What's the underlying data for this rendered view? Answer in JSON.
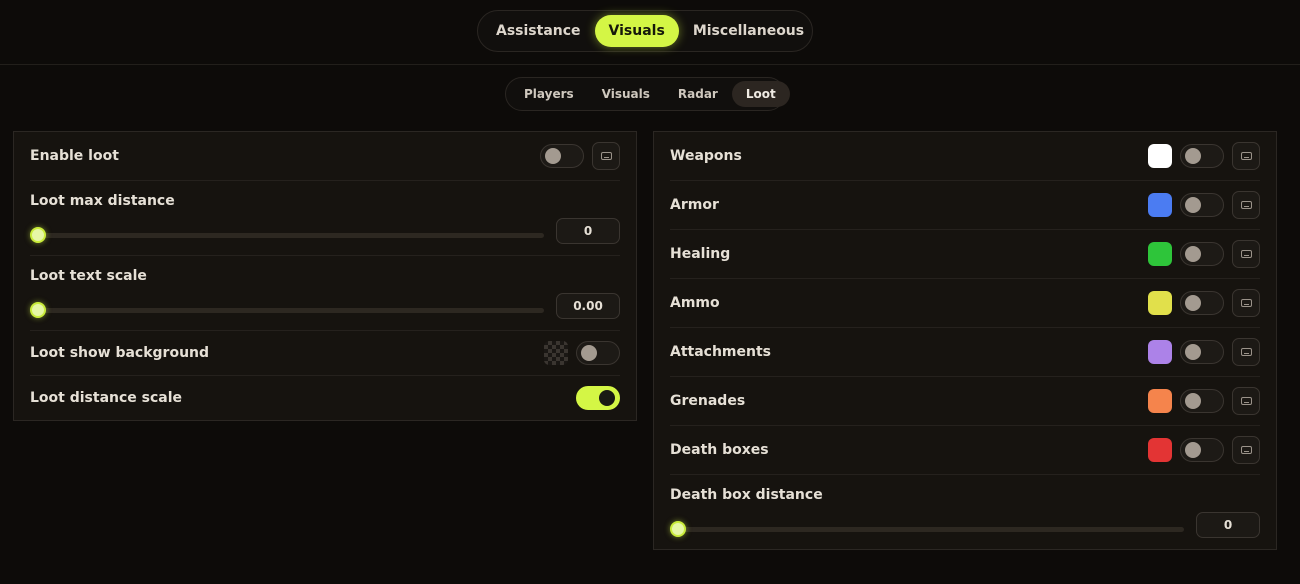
{
  "top_tabs": [
    {
      "label": "Assistance",
      "active": false
    },
    {
      "label": "Visuals",
      "active": true
    },
    {
      "label": "Miscellaneous",
      "active": false
    }
  ],
  "sub_tabs": [
    {
      "label": "Players",
      "active": false
    },
    {
      "label": "Visuals",
      "active": false
    },
    {
      "label": "Radar",
      "active": false
    },
    {
      "label": "Loot",
      "active": true
    }
  ],
  "left_panel": {
    "enable_loot": {
      "label": "Enable loot",
      "on": false
    },
    "loot_max_distance": {
      "label": "Loot max distance",
      "value": "0",
      "fraction": 0
    },
    "loot_text_scale": {
      "label": "Loot text scale",
      "value": "0.00",
      "fraction": 0
    },
    "loot_show_background": {
      "label": "Loot show background",
      "on": false
    },
    "loot_distance_scale": {
      "label": "Loot distance scale",
      "on": true
    }
  },
  "right_panel": {
    "items": [
      {
        "label": "Weapons",
        "color": "#ffffff",
        "on": false
      },
      {
        "label": "Armor",
        "color": "#4b7cf2",
        "on": false
      },
      {
        "label": "Healing",
        "color": "#2ec53a",
        "on": false
      },
      {
        "label": "Ammo",
        "color": "#e1e04b",
        "on": false
      },
      {
        "label": "Attachments",
        "color": "#ac82e8",
        "on": false
      },
      {
        "label": "Grenades",
        "color": "#f5844c",
        "on": false
      },
      {
        "label": "Death boxes",
        "color": "#e33434",
        "on": false
      }
    ],
    "death_box_distance": {
      "label": "Death box distance",
      "value": "0",
      "fraction": 0
    }
  },
  "colors": {
    "accent": "#d4f645",
    "background": "#0d0b09",
    "panel": "#16130f"
  },
  "icons": {
    "keybind": "keyboard-icon",
    "transparent_color": "checkerboard-swatch"
  }
}
